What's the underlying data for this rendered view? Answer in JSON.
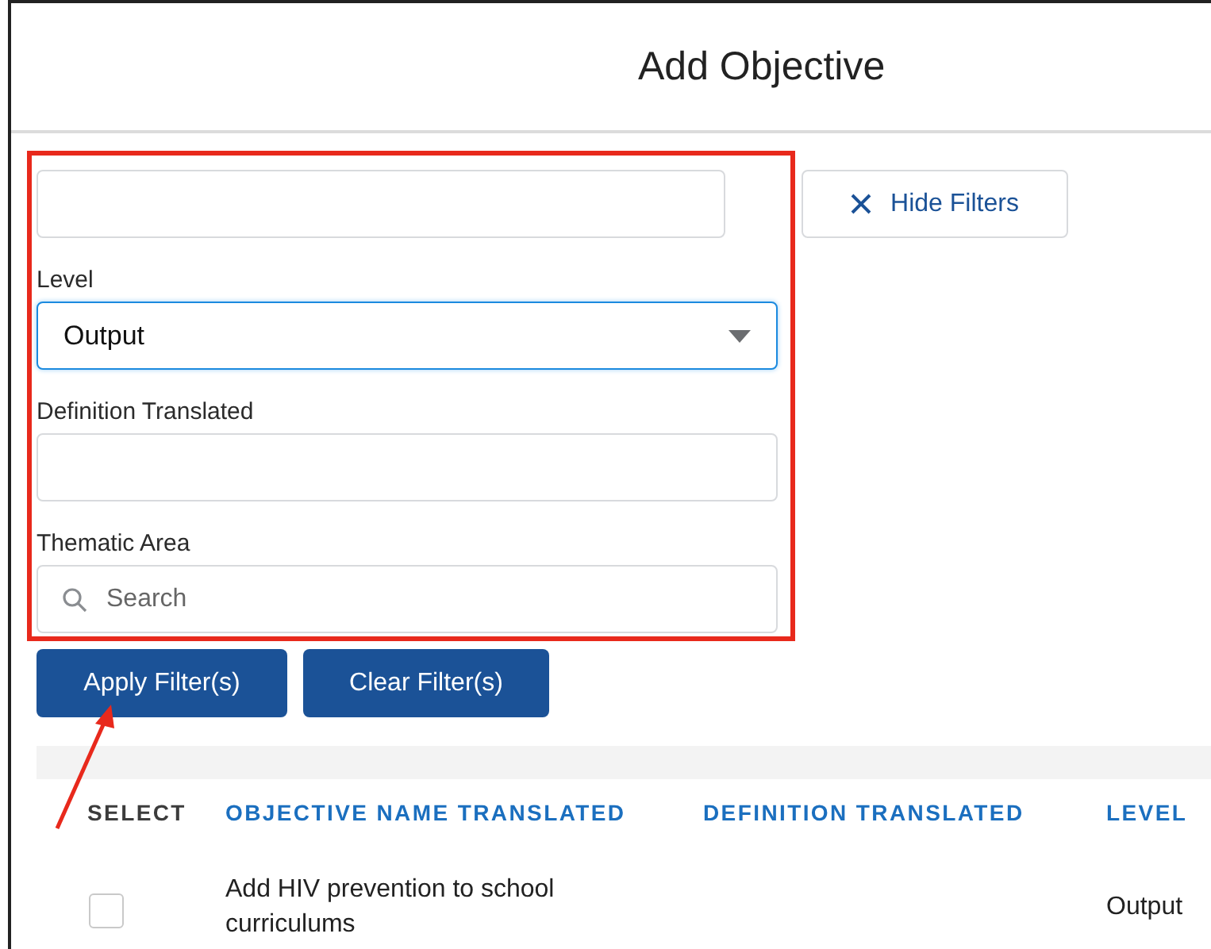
{
  "window": {
    "title": "Add Objective"
  },
  "filters": {
    "fields": [
      {
        "kind": "text",
        "focused": false
      },
      {
        "kind": "select",
        "label": "Level",
        "value": "Output",
        "focused": true
      },
      {
        "kind": "text",
        "label": "Definition Translated",
        "focused": false
      },
      {
        "kind": "search",
        "label": "Thematic Area",
        "placeholder": "Search",
        "focused": false
      }
    ],
    "hide_button": "Hide Filters"
  },
  "buttons": [
    "Apply Filter(s)",
    "Clear Filter(s)"
  ],
  "table": {
    "columns": [
      {
        "label": "SELECT",
        "kind": "plain"
      },
      {
        "label": "OBJECTIVE NAME TRANSLATED",
        "kind": "link"
      },
      {
        "label": "DEFINITION TRANSLATED",
        "kind": "link"
      },
      {
        "label": "LEVEL",
        "kind": "link"
      }
    ],
    "rows": [
      {
        "checked": false,
        "objective_name": "Add HIV prevention to school curriculums",
        "level": "Output"
      }
    ]
  }
}
